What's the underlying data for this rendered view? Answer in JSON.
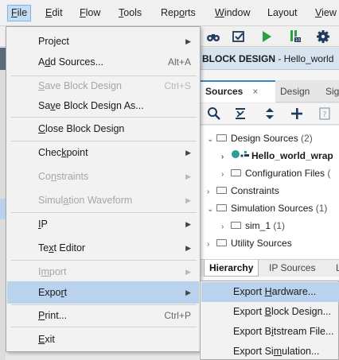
{
  "menubar": {
    "items": [
      {
        "label": "File",
        "mnemonic": "F",
        "rest": "ile"
      },
      {
        "label": "Edit",
        "mnemonic": "E",
        "rest": "dit"
      },
      {
        "label": "Flow",
        "mnemonic": "F",
        "rest": "low"
      },
      {
        "label": "Tools",
        "mnemonic": "T",
        "rest": "ools"
      },
      {
        "label": "Reports",
        "pre": "Rep",
        "mnemonic": "o",
        "rest": "rts"
      },
      {
        "label": "Window",
        "mnemonic": "W",
        "rest": "indow"
      },
      {
        "label": "Layout",
        "pre": "Layout",
        "mnemonic": "",
        "rest": ""
      },
      {
        "label": "View",
        "mnemonic": "V",
        "rest": "iew"
      }
    ]
  },
  "toolbar": {
    "icons": [
      "binoculars-icon",
      "checkbox-icon",
      "run-icon",
      "bitstream-icon",
      "gear-icon"
    ]
  },
  "block_design": {
    "title": "BLOCK DESIGN",
    "subtitle": " - Hello_world"
  },
  "tabs": {
    "sources": "Sources",
    "close": "×",
    "design": "Design",
    "signals": "Sig"
  },
  "tree": {
    "design_sources": "Design Sources",
    "design_sources_count": " (2)",
    "hello_world_wrap": "Hello_world_wrap",
    "configuration_files": "Configuration Files",
    "configuration_files_count": " (",
    "constraints": "Constraints",
    "simulation_sources": "Simulation Sources",
    "simulation_sources_count": " (1)",
    "sim_1": "sim_1",
    "sim_1_count": " (1)",
    "utility_sources": "Utility Sources"
  },
  "bottom_tabs": {
    "hierarchy": "Hierarchy",
    "ip_sources": "IP Sources",
    "libraries": "L"
  },
  "file_menu": {
    "project": {
      "pre": "Pro",
      "u": "j",
      "post": "ect"
    },
    "add_sources": {
      "pre": "A",
      "u": "d",
      "post": "d Sources...",
      "accel": "Alt+A"
    },
    "save_block_design": {
      "u": "S",
      "post": "ave Block Design",
      "accel": "Ctrl+S"
    },
    "save_block_design_as": {
      "pre": "Sa",
      "u": "v",
      "post": "e Block Design As..."
    },
    "close_block_design": {
      "u": "C",
      "post": "lose Block Design"
    },
    "checkpoint": {
      "pre": "Chec",
      "u": "k",
      "post": "point"
    },
    "constraints": {
      "pre": "Co",
      "u": "n",
      "post": "straints"
    },
    "simulation_waveform": {
      "pre": "Simul",
      "u": "a",
      "post": "tion Waveform"
    },
    "ip": {
      "u": "I",
      "post": "P"
    },
    "text_editor": {
      "pre": "Te",
      "u": "x",
      "post": "t Editor"
    },
    "import": {
      "pre": "I",
      "u": "m",
      "post": "port"
    },
    "export": {
      "pre": "Expo",
      "u": "r",
      "post": "t"
    },
    "print": {
      "u": "P",
      "post": "rint...",
      "accel": "Ctrl+P"
    },
    "exit": {
      "u": "E",
      "post": "xit"
    }
  },
  "export_menu": {
    "hardware": {
      "pre": "Export ",
      "u": "H",
      "post": "ardware..."
    },
    "block_design": {
      "pre": "Export ",
      "u": "B",
      "post": "lock Design..."
    },
    "bitstream": {
      "pre": "Export B",
      "u": "i",
      "post": "tstream File..."
    },
    "simulation": {
      "pre": "Export Si",
      "u": "m",
      "post": "ulation..."
    }
  },
  "colors": {
    "highlight": "#b9d3ee",
    "accent": "#3d82c6",
    "disabled": "#a6a6a6"
  }
}
